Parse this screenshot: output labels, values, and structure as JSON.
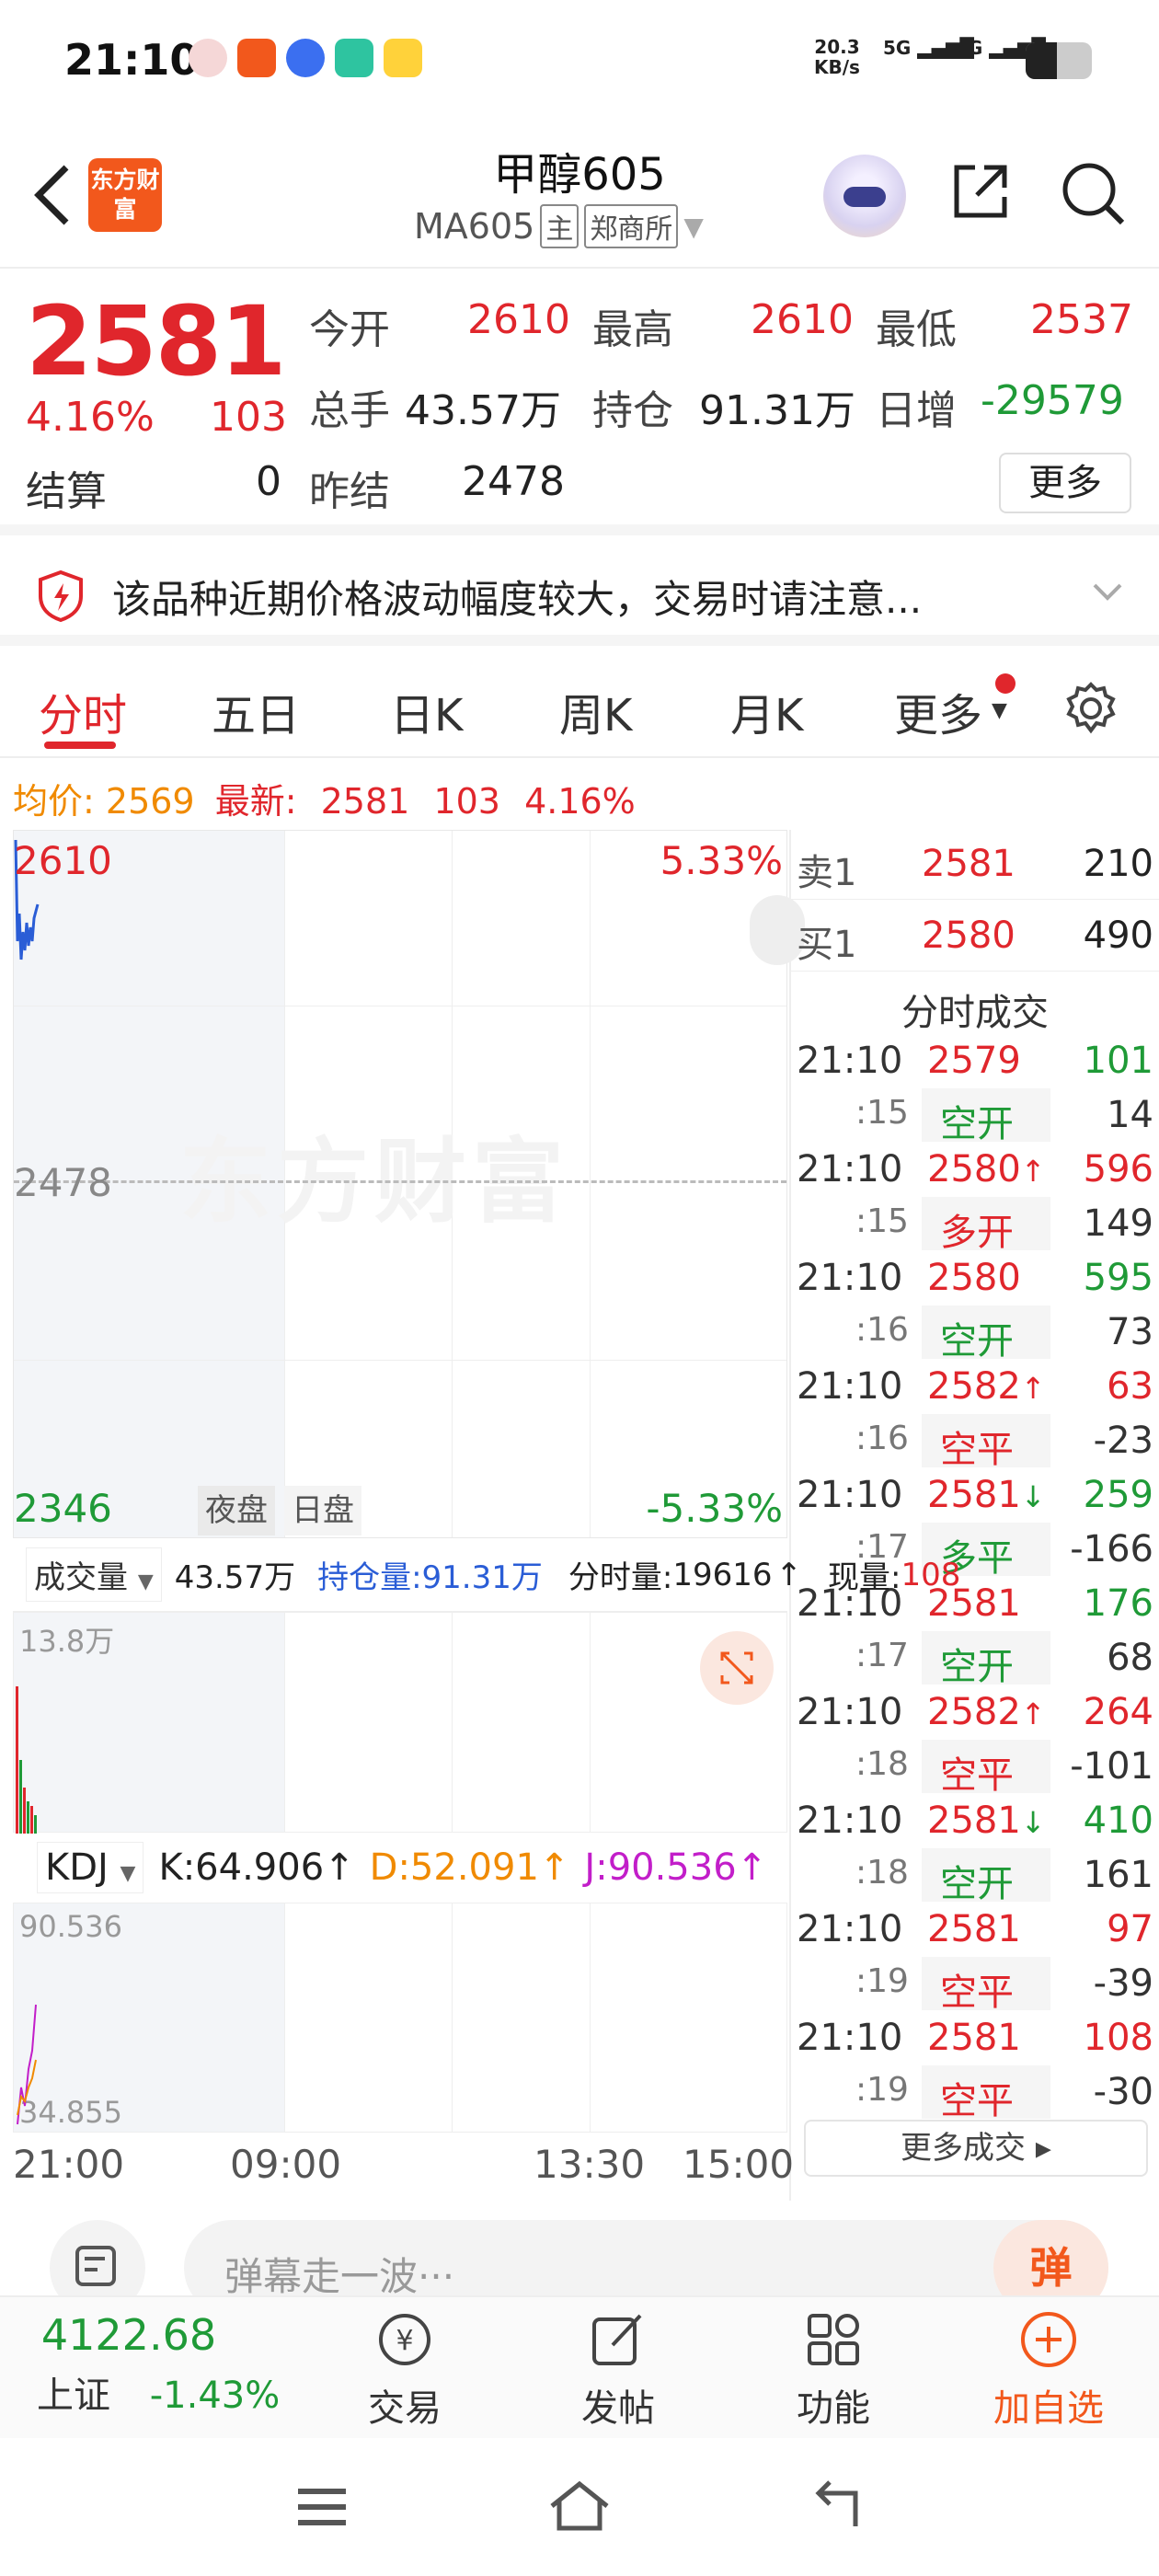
{
  "status_bar": {
    "time": "21:10",
    "net_speed_value": "20.3",
    "net_speed_unit": "KB/s",
    "signal1": "5G",
    "signal2": "4G"
  },
  "header": {
    "logo_text": "东方财富",
    "title": "甲醇605",
    "code": "MA605",
    "tag_main": "主",
    "tag_exchange": "郑商所"
  },
  "quote": {
    "price": "2581",
    "change_pct": "4.16%",
    "change": "103",
    "open_label": "今开",
    "open": "2610",
    "high_label": "最高",
    "high": "2610",
    "low_label": "最低",
    "low": "2537",
    "volume_label": "总手",
    "volume": "43.57万",
    "oi_label": "持仓",
    "oi": "91.31万",
    "oi_change_label": "日增",
    "oi_change": "-29579",
    "settle_label": "结算",
    "settle": "0",
    "prev_settle_label": "昨结",
    "prev_settle": "2478",
    "more_btn": "更多"
  },
  "alert": {
    "text": "该品种近期价格波动幅度较大，交易时请注意..."
  },
  "tabs": [
    "分时",
    "五日",
    "日K",
    "周K",
    "月K",
    "更多"
  ],
  "avg_line": {
    "avg_label": "均价:",
    "avg": "2569",
    "latest_label": "最新:",
    "latest": "2581",
    "chg": "103",
    "pct": "4.16%"
  },
  "chart": {
    "top_price": "2610",
    "top_pct": "5.33%",
    "mid_price": "2478",
    "bottom_price": "2346",
    "bottom_pct": "-5.33%",
    "session_night": "夜盘",
    "session_day": "日盘",
    "watermark": "东方财富",
    "times": [
      "21:00",
      "09:00",
      "13:30",
      "15:00"
    ]
  },
  "orderbook": {
    "ask_label": "卖1",
    "ask_price": "2581",
    "ask_vol": "210",
    "bid_label": "买1",
    "bid_price": "2580",
    "bid_vol": "490",
    "ticks_title": "分时成交",
    "ticks": [
      {
        "time": "21:10",
        "sec": ":15",
        "price": "2579",
        "arrow": "",
        "vol": "101",
        "vol_color": "green",
        "type": "空开",
        "type_color": "green",
        "oi": "14"
      },
      {
        "time": "21:10",
        "sec": ":15",
        "price": "2580",
        "arrow": "↑",
        "vol": "596",
        "vol_color": "red",
        "type": "多开",
        "type_color": "red",
        "oi": "149"
      },
      {
        "time": "21:10",
        "sec": ":16",
        "price": "2580",
        "arrow": "",
        "vol": "595",
        "vol_color": "green",
        "type": "空开",
        "type_color": "green",
        "oi": "73"
      },
      {
        "time": "21:10",
        "sec": ":16",
        "price": "2582",
        "arrow": "↑",
        "vol": "63",
        "vol_color": "red",
        "type": "空平",
        "type_color": "red",
        "oi": "-23"
      },
      {
        "time": "21:10",
        "sec": ":17",
        "price": "2581",
        "arrow": "↓",
        "vol": "259",
        "vol_color": "green",
        "type": "多平",
        "type_color": "green",
        "oi": "-166"
      },
      {
        "time": "21:10",
        "sec": ":17",
        "price": "2581",
        "arrow": "",
        "vol": "176",
        "vol_color": "green",
        "type": "空开",
        "type_color": "green",
        "oi": "68"
      },
      {
        "time": "21:10",
        "sec": ":18",
        "price": "2582",
        "arrow": "↑",
        "vol": "264",
        "vol_color": "red",
        "type": "空平",
        "type_color": "red",
        "oi": "-101"
      },
      {
        "time": "21:10",
        "sec": ":18",
        "price": "2581",
        "arrow": "↓",
        "vol": "410",
        "vol_color": "green",
        "type": "空开",
        "type_color": "green",
        "oi": "161"
      },
      {
        "time": "21:10",
        "sec": ":19",
        "price": "2581",
        "arrow": "",
        "vol": "97",
        "vol_color": "red",
        "type": "空平",
        "type_color": "red",
        "oi": "-39"
      },
      {
        "time": "21:10",
        "sec": ":19",
        "price": "2581",
        "arrow": "",
        "vol": "108",
        "vol_color": "red",
        "type": "空平",
        "type_color": "red",
        "oi": "-30"
      }
    ],
    "more_btn": "更多成交"
  },
  "volume": {
    "selector": "成交量",
    "vol": "43.57万",
    "oi_label": "持仓量:",
    "oi": "91.31万",
    "tick_vol_label": "分时量:",
    "tick_vol": "19616",
    "now_label": "现量:",
    "now": "108",
    "max": "13.8万"
  },
  "kdj": {
    "selector": "KDJ",
    "k": "K:64.906",
    "d": "D:52.091",
    "j": "J:90.536",
    "top": "90.536",
    "bottom": "34.855"
  },
  "comment": {
    "placeholder": "弹幕走一波···",
    "button": "弹"
  },
  "bottom_nav": {
    "index_value": "4122.68",
    "index_name": "上证",
    "index_pct": "-1.43%",
    "trade": "交易",
    "post": "发帖",
    "function": "功能",
    "add": "加自选"
  },
  "colors": {
    "red": "#e0262c",
    "green": "#1f9a37",
    "orange": "#f08a00",
    "brand": "#f2581c"
  }
}
